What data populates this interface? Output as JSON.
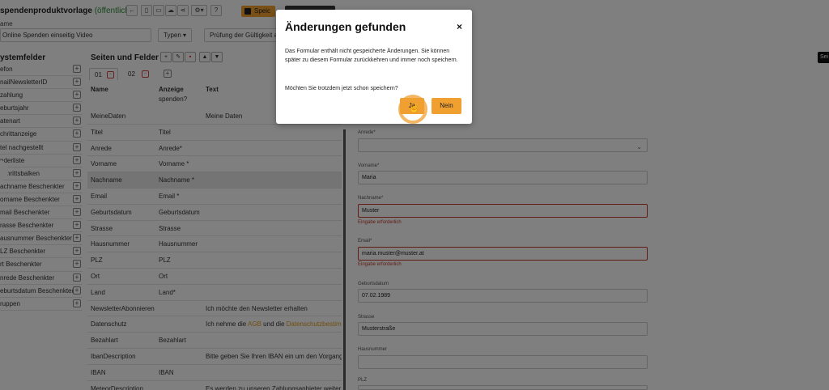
{
  "header": {
    "title": "spendenproduktvorlage",
    "visibility": "(öffentlich)",
    "save_label": "Speic"
  },
  "template": {
    "name_label": "ame",
    "name_value": "Online Spenden einseitig Video",
    "types_label": "Typen",
    "validity_label": "Prüfung der Gültigkeit a",
    "tooltip_text": "Sei"
  },
  "system_fields": {
    "title": "ystemfelder",
    "items": [
      "efon",
      "nailNewsletterID",
      "zahlung",
      "eburtsjahr",
      "atenart",
      "chrittanzeige",
      "tel nachgestellt",
      "nderliste",
      "schrittsbalken",
      "achname Beschenkter",
      "orname Beschenkter",
      "mail Beschenkter",
      "rasse Beschenkter",
      "ausnummer Beschenkter",
      "LZ Beschenkter",
      "rt Beschenkter",
      "nrede Beschenkter",
      "eburtsdatum Beschenkter",
      "ruppen"
    ]
  },
  "pages": {
    "title": "Seiten und Felder",
    "tabs": [
      "01",
      "02"
    ],
    "columns": {
      "name": "Name",
      "display": "Anzeige",
      "text": "Text",
      "display_cont": "spenden?"
    },
    "rows": [
      {
        "name": "MeineDaten",
        "display": "",
        "text": "Meine Daten"
      },
      {
        "name": "Titel",
        "display": "Titel",
        "text": ""
      },
      {
        "name": "Anrede",
        "display": "Anrede*",
        "text": ""
      },
      {
        "name": "Vorname",
        "display": "Vorname *",
        "text": ""
      },
      {
        "name": "Nachname",
        "display": "Nachname *",
        "text": ""
      },
      {
        "name": "Email",
        "display": "Email *",
        "text": ""
      },
      {
        "name": "Geburtsdatum",
        "display": "Geburtsdatum",
        "text": ""
      },
      {
        "name": "Strasse",
        "display": "Strasse",
        "text": ""
      },
      {
        "name": "Hausnummer",
        "display": "Hausnummer",
        "text": ""
      },
      {
        "name": "PLZ",
        "display": "PLZ",
        "text": ""
      },
      {
        "name": "Ort",
        "display": "Ort",
        "text": ""
      },
      {
        "name": "Land",
        "display": "Land*",
        "text": ""
      },
      {
        "name": "NewsletterAbonnieren",
        "display": "",
        "text": "Ich möchte den Newsletter erhalten"
      },
      {
        "name": "Datenschutz",
        "display": "",
        "text": ""
      },
      {
        "name": "Bezahlart",
        "display": "Bezahlart",
        "text": ""
      },
      {
        "name": "IbanDescription",
        "display": "",
        "text": "Bitte geben Sie Ihren IBAN ein um den Vorgang a"
      },
      {
        "name": "IBAN",
        "display": "IBAN",
        "text": ""
      },
      {
        "name": "MeteorDescription",
        "display": "",
        "text": "Es werden zu unseren Zahlungsanbieter weiter"
      }
    ],
    "privacy_text": {
      "pre": "Ich nehme die ",
      "agb": "AGB",
      "mid": " und die ",
      "link": "Datenschutzbestimm"
    }
  },
  "preview": {
    "anrede_label": "Anrede*",
    "vorname_label": "Vorname*",
    "vorname_value": "Maria",
    "nachname_label": "Nachname*",
    "nachname_value": "Muster",
    "nachname_error": "Eingabe erforderlich",
    "email_label": "Email*",
    "email_value": "maria.muster@muster.at",
    "email_error": "Eingabe erforderlich",
    "geburtsdatum_label": "Geburtsdatum",
    "geburtsdatum_value": "07.02.1989",
    "strasse_label": "Strasse",
    "strasse_value": "Musterstraße",
    "hausnummer_label": "Hausnummer",
    "plz_label": "PLZ"
  },
  "modal": {
    "title": "Änderungen gefunden",
    "close": "×",
    "message": "Das Formular enthält nicht gespeicherte Änderungen. Sie können später zu diesem Formular zurückkehren und immer noch speichern.",
    "question": "Möchten Sie trotzdem jetzt schon speichern?",
    "yes_label": "Ja",
    "no_label": "Nein"
  },
  "colors": {
    "accent": "#f0a030",
    "error": "#c0392b",
    "public": "#2e8b3a"
  }
}
